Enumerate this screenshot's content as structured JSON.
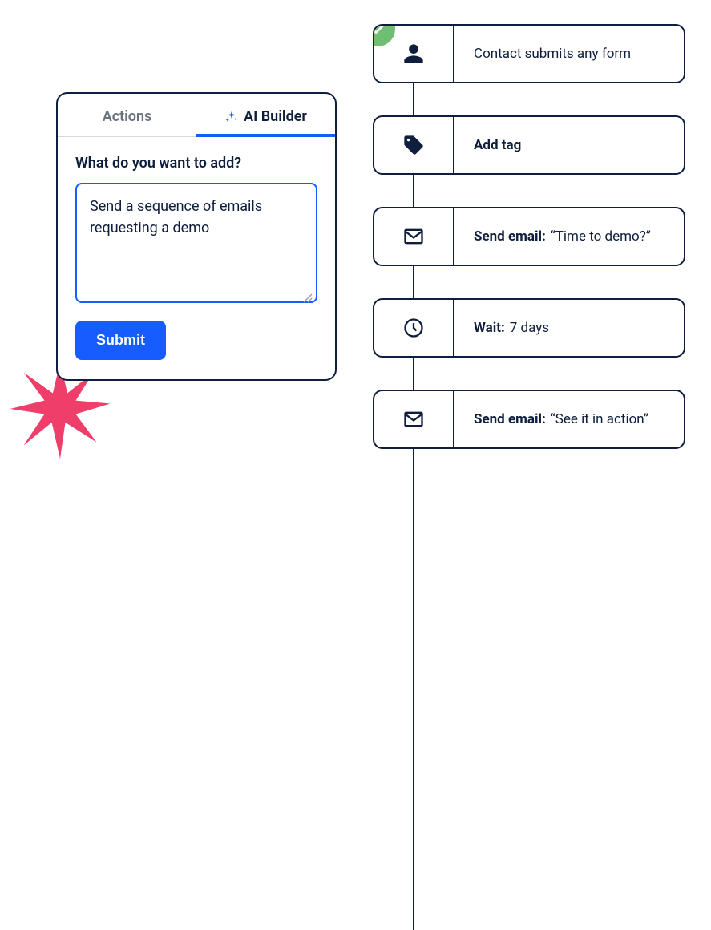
{
  "builder": {
    "tabs": {
      "actions": "Actions",
      "ai_builder": "AI Builder"
    },
    "prompt_label": "What do you want to add?",
    "prompt_value": "Send a sequence of emails requesting a demo",
    "submit_label": "Submit"
  },
  "flow": [
    {
      "icon": "person-icon",
      "label_bold": "",
      "label_rest": "Contact submits any form",
      "has_check": true
    },
    {
      "icon": "tag-icon",
      "label_bold": "Add tag",
      "label_rest": ""
    },
    {
      "icon": "envelope-icon",
      "label_bold": "Send email:",
      "label_rest": "“Time to demo?”"
    },
    {
      "icon": "clock-icon",
      "label_bold": "Wait:",
      "label_rest": "7 days"
    },
    {
      "icon": "envelope-icon",
      "label_bold": "Send email:",
      "label_rest": "“See it in action”"
    }
  ],
  "colors": {
    "accent": "#175cff",
    "dark": "#0f1e3d",
    "success": "#6fbf73",
    "starburst": "#ef3e6a"
  }
}
